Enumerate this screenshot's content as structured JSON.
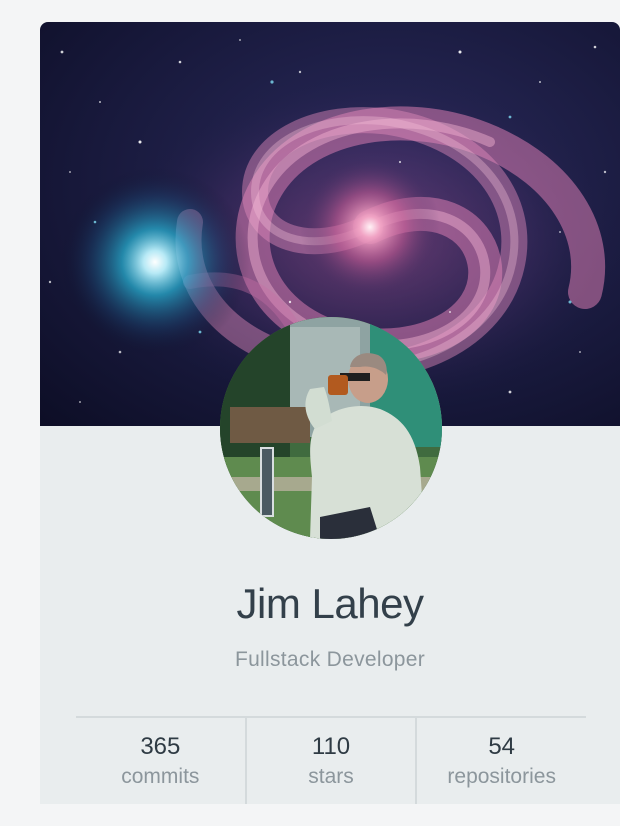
{
  "profile": {
    "name": "Jim Lahey",
    "role": "Fullstack Developer"
  },
  "stats": [
    {
      "value": "365",
      "label": "commits"
    },
    {
      "value": "110",
      "label": "stars"
    },
    {
      "value": "54",
      "label": "repositories"
    }
  ],
  "images": {
    "cover": "galaxy-cover-image",
    "avatar": "profile-photo"
  }
}
